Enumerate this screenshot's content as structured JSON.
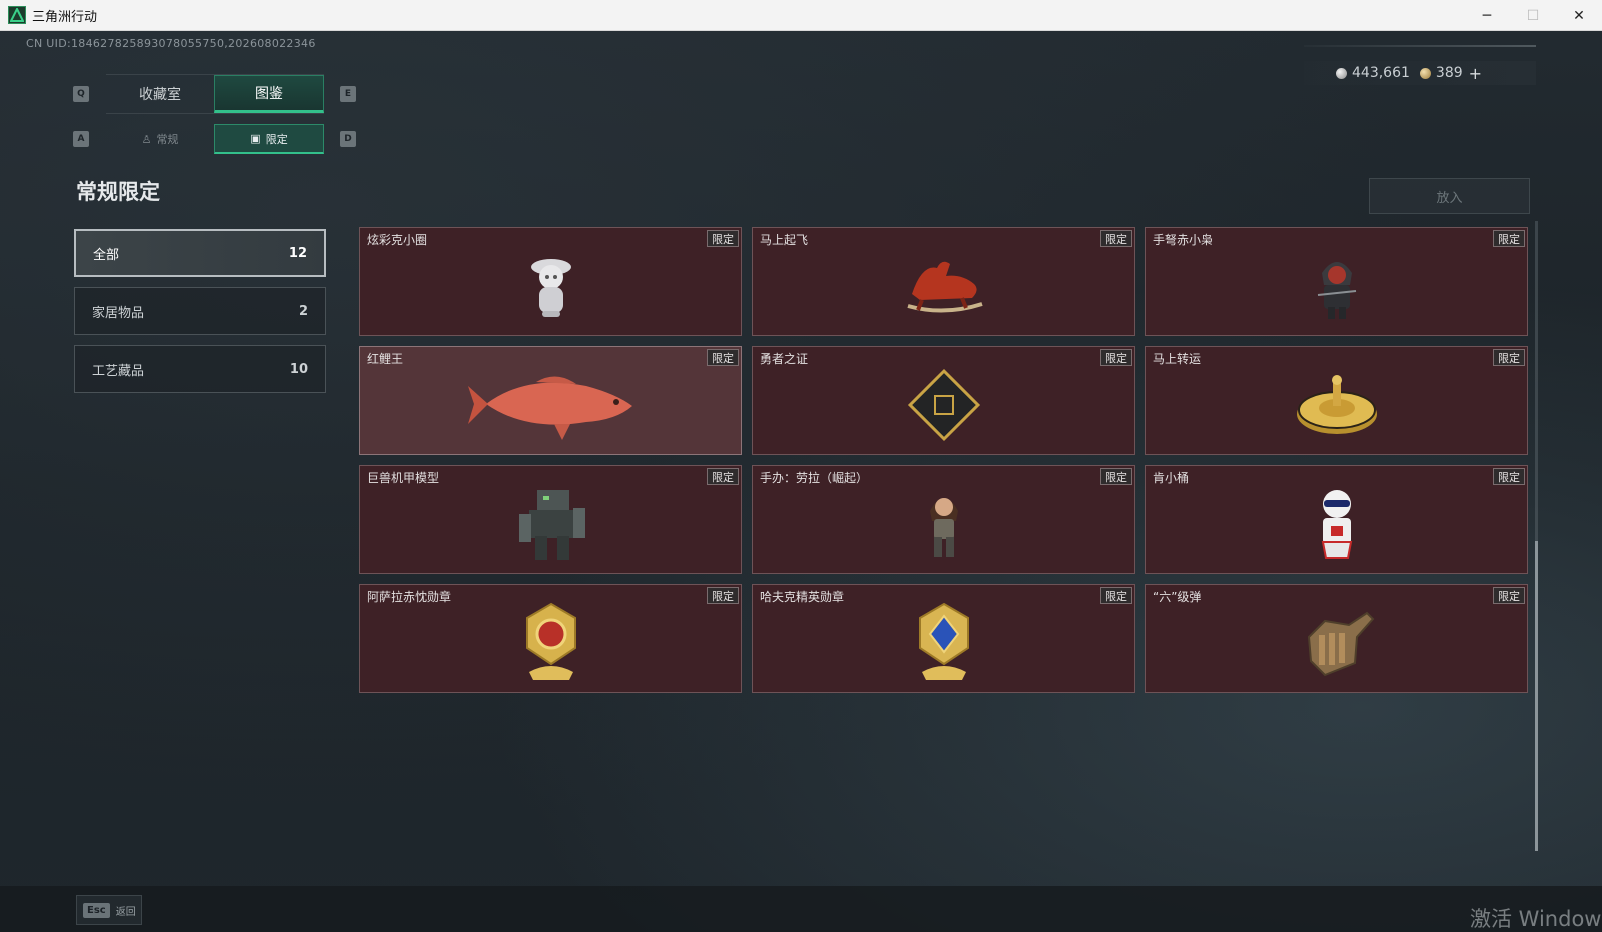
{
  "window": {
    "title": "三角洲行动",
    "minimize": "─",
    "maximize": "☐",
    "close": "✕"
  },
  "header": {
    "uid": "CN UID:184627825893078055750,202608022346",
    "currency": {
      "silver": "443,661",
      "gold": "389",
      "plus": "+"
    }
  },
  "tabs": {
    "key_left": "Q",
    "key_right": "E",
    "items": [
      {
        "label": "收藏室",
        "active": false
      },
      {
        "label": "图鉴",
        "active": true
      }
    ]
  },
  "subtabs": {
    "key_left": "A",
    "key_right": "D",
    "items": [
      {
        "label": "常规",
        "icon": "figure-icon",
        "active": false
      },
      {
        "label": "限定",
        "icon": "picture-icon",
        "active": true
      }
    ]
  },
  "section_title": "常规限定",
  "categories": [
    {
      "label": "全部",
      "count": "12",
      "active": true
    },
    {
      "label": "家居物品",
      "count": "2",
      "active": false
    },
    {
      "label": "工艺藏品",
      "count": "10",
      "active": false
    }
  ],
  "put_button": "放入",
  "items": [
    {
      "name": "炫彩克小圈",
      "badge": "限定",
      "art": "toy-figure"
    },
    {
      "name": "马上起飞",
      "badge": "限定",
      "art": "red-horse"
    },
    {
      "name": "手弩赤小枭",
      "badge": "限定",
      "art": "hooded-figure"
    },
    {
      "name": "红鲤王",
      "badge": "限定",
      "art": "carp"
    },
    {
      "name": "勇者之证",
      "badge": "限定",
      "art": "card-emblem"
    },
    {
      "name": "马上转运",
      "badge": "限定",
      "art": "gold-wheel"
    },
    {
      "name": "巨兽机甲模型",
      "badge": "限定",
      "art": "mech"
    },
    {
      "name": "手办：劳拉（崛起）",
      "badge": "限定",
      "art": "lara-figure"
    },
    {
      "name": "肯小桶",
      "badge": "限定",
      "art": "bucket-figure"
    },
    {
      "name": "阿萨拉赤忱勋章",
      "badge": "限定",
      "art": "red-medal"
    },
    {
      "name": "哈夫克精英勋章",
      "badge": "限定",
      "art": "blue-medal"
    },
    {
      "name": "“六”级弹",
      "badge": "限定",
      "art": "bullet-hand"
    }
  ],
  "footer": {
    "esc_key": "Esc",
    "esc_label": "返回"
  },
  "watermark": "激活 Windows"
}
